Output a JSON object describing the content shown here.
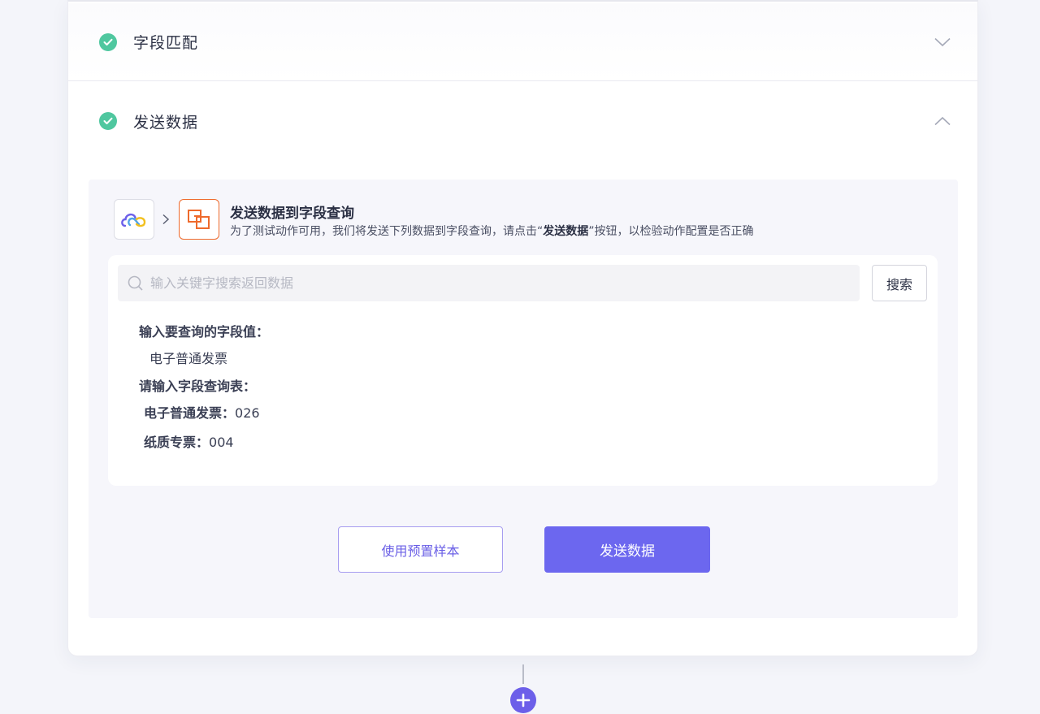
{
  "sections": [
    {
      "title": "字段匹配",
      "status": "complete",
      "expanded": false
    },
    {
      "title": "发送数据",
      "status": "complete",
      "expanded": true
    }
  ],
  "send_panel": {
    "title": "发送数据到字段查询",
    "description_prefix": "为了测试动作可用，我们将发送下列数据到字段查询，请点击“",
    "description_bold": "发送数据",
    "description_suffix": "”按钮，以检验动作配置是否正确",
    "search_placeholder": "输入关键字搜索返回数据",
    "search_button": "搜索",
    "field1_label": "输入要查询的字段值：",
    "field1_value": "电子普通发票",
    "field2_label": "请输入字段查询表：",
    "rows": [
      {
        "key": "电子普通发票：",
        "value": "026"
      },
      {
        "key": "纸质专票：",
        "value": "004"
      }
    ],
    "sample_button": "使用预置样本",
    "send_button": "发送数据"
  },
  "colors": {
    "accent": "#6c67ef",
    "success": "#4fc79f",
    "target_icon": "#ee6a2c"
  },
  "icons": {
    "check": "check-circle-icon",
    "collapse": "chevron-up-icon",
    "expand": "chevron-down-icon",
    "source_app": "cloud-app-icon",
    "target_app": "field-lookup-icon",
    "search": "search-icon",
    "add": "plus-circle-icon"
  }
}
